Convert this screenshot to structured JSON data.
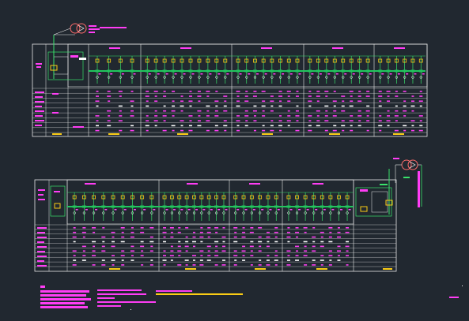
{
  "viewport": {
    "background": "#212830"
  },
  "colors": {
    "frame": "#e8e8e8",
    "busbar": "#22c55e",
    "feeder": "#39e26b",
    "breaker": "#facc15",
    "annotation": "#ff3df5",
    "transformer": "#ff6b6b",
    "tag": "#ffffff"
  },
  "drawings": [
    {
      "name": "upper-switchgear-lineup",
      "panels": 5,
      "feeders_per_panel": [
        4,
        10,
        8,
        8,
        6
      ],
      "table_rows": 9
    },
    {
      "name": "lower-switchgear-lineup",
      "panels": 5,
      "feeders_per_panel": [
        9,
        9,
        6,
        8,
        2
      ],
      "table_rows": 9
    }
  ],
  "transformers": [
    {
      "name": "upper-transformer-symbol"
    },
    {
      "name": "lower-transformer-symbol"
    }
  ],
  "notes": {
    "left_lines": 5,
    "middle_lines": 5,
    "highlight": "yellow"
  }
}
